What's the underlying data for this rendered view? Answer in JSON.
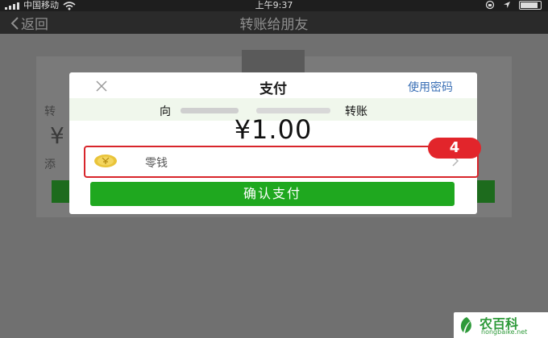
{
  "status_bar": {
    "carrier": "中国移动",
    "time": "上午9:37"
  },
  "nav": {
    "back_label": "返回",
    "title": "转账给朋友"
  },
  "background": {
    "label_transfer": "转",
    "currency": "¥",
    "label_add": "添"
  },
  "dialog": {
    "title": "支付",
    "use_password": "使用密码",
    "to_prefix": "向",
    "to_suffix": "转账",
    "amount": "¥1.00",
    "payment_method": "零钱",
    "step_number": "4",
    "confirm_label": "确认支付"
  },
  "watermark": {
    "name": "农百科",
    "domain": "nongbaike.net"
  },
  "colors": {
    "accent_green": "#1fa81f",
    "link_blue": "#3a6fb5",
    "highlight_red": "#e2252b"
  }
}
